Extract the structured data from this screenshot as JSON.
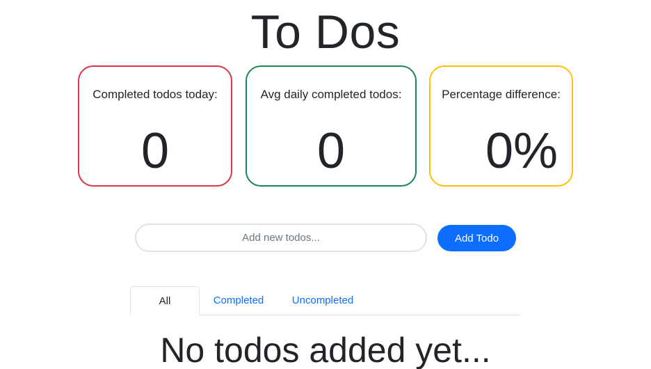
{
  "header": {
    "title": "To Dos"
  },
  "stats": [
    {
      "label": "Completed todos today:",
      "value": "0",
      "color": "#dc3545"
    },
    {
      "label": "Avg daily completed todos:",
      "value": "0",
      "color": "#198754"
    },
    {
      "label": "Percentage difference:",
      "value": "0%",
      "color": "#ffc107"
    }
  ],
  "form": {
    "placeholder": "Add new todos...",
    "value": "",
    "add_label": "Add Todo",
    "add_color": "#0d6efd"
  },
  "tabs": [
    {
      "label": "All",
      "active": true
    },
    {
      "label": "Completed",
      "active": false
    },
    {
      "label": "Uncompleted",
      "active": false
    }
  ],
  "list": {
    "empty_message": "No todos added yet..."
  }
}
